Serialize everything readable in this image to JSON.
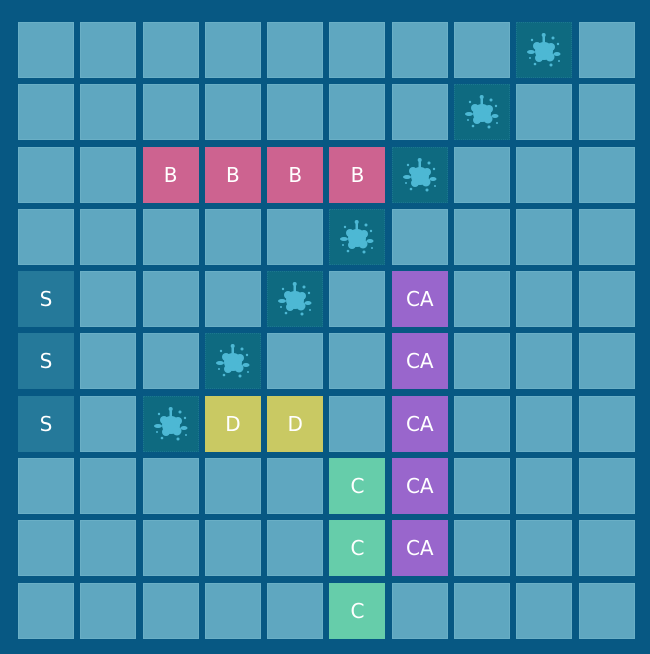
{
  "game": "battleship",
  "colors": {
    "background": "#075883",
    "water": "#5fa7c0",
    "miss_cell": "#0e6a80",
    "splash": "#4db8d4",
    "B": "#cd6390",
    "S": "#25799a",
    "D": "#c9c963",
    "C": "#66cdaa",
    "CA": "#9966cc"
  },
  "legend": {
    "": "water",
    "X": "splash-icon (miss)"
  },
  "board": [
    [
      "",
      "",
      "",
      "",
      "",
      "",
      "",
      "",
      "X",
      ""
    ],
    [
      "",
      "",
      "",
      "",
      "",
      "",
      "",
      "X",
      "",
      ""
    ],
    [
      "",
      "",
      "B",
      "B",
      "B",
      "B",
      "X",
      "",
      "",
      ""
    ],
    [
      "",
      "",
      "",
      "",
      "",
      "X",
      "",
      "",
      "",
      ""
    ],
    [
      "S",
      "",
      "",
      "",
      "X",
      "",
      "CA",
      "",
      "",
      ""
    ],
    [
      "S",
      "",
      "",
      "X",
      "",
      "",
      "CA",
      "",
      "",
      ""
    ],
    [
      "S",
      "",
      "X",
      "D",
      "D",
      "",
      "CA",
      "",
      "",
      ""
    ],
    [
      "",
      "",
      "",
      "",
      "",
      "C",
      "CA",
      "",
      "",
      ""
    ],
    [
      "",
      "",
      "",
      "",
      "",
      "C",
      "CA",
      "",
      "",
      ""
    ],
    [
      "",
      "",
      "",
      "",
      "",
      "C",
      "",
      "",
      "",
      ""
    ]
  ]
}
